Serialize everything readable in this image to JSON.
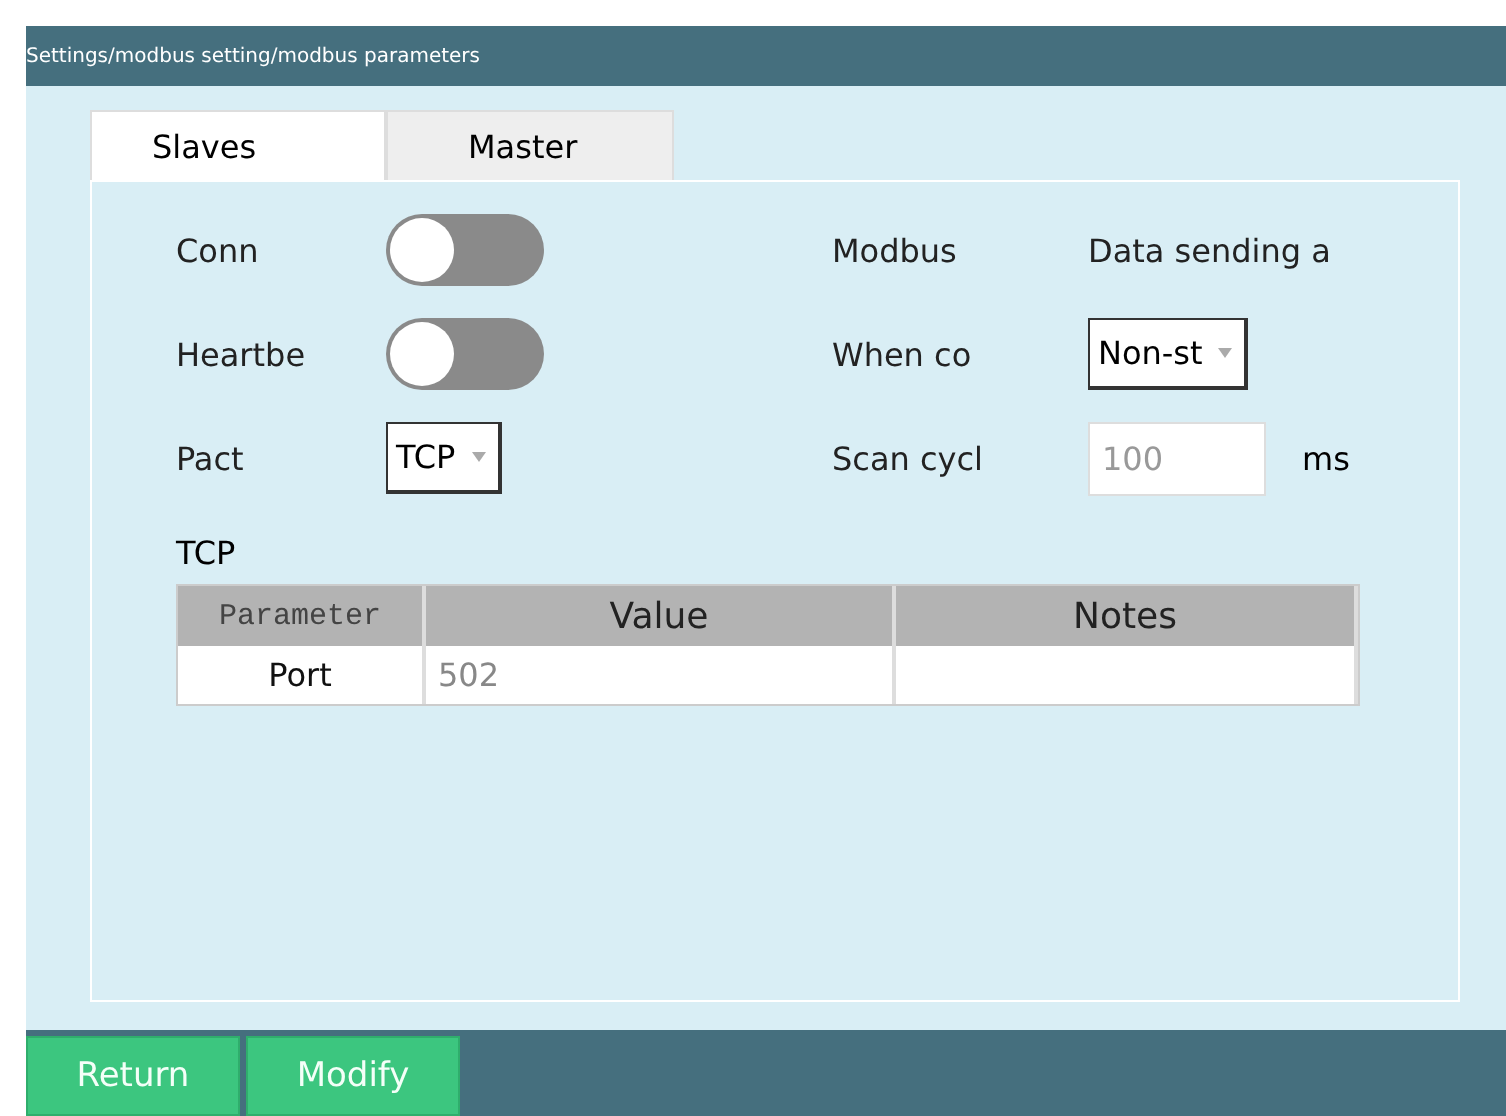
{
  "breadcrumb": "Settings/modbus setting/modbus parameters",
  "tabs": [
    {
      "label": "Slaves",
      "selected": true
    },
    {
      "label": "Master",
      "selected": false
    }
  ],
  "left_fields": [
    {
      "kind": "toggle",
      "label": "Conn",
      "on": false
    },
    {
      "kind": "toggle",
      "label": "Heartbe",
      "on": false
    },
    {
      "kind": "dropdown",
      "label": "Pact",
      "value": "TCP"
    }
  ],
  "right_fields": [
    {
      "kind": "text",
      "label": "Modbus",
      "value": "Data sending a"
    },
    {
      "kind": "dropdown",
      "label": "When co",
      "value": "Non-st"
    },
    {
      "kind": "input",
      "label": "Scan cycl",
      "value": "100",
      "disabled": true,
      "unit": "ms"
    }
  ],
  "section_title": "TCP",
  "table": {
    "columns": [
      "Parameter",
      "Value",
      "Notes"
    ],
    "rows": [
      [
        "Port",
        "502"
      ]
    ]
  },
  "buttons": [
    "Return",
    "Modify"
  ]
}
